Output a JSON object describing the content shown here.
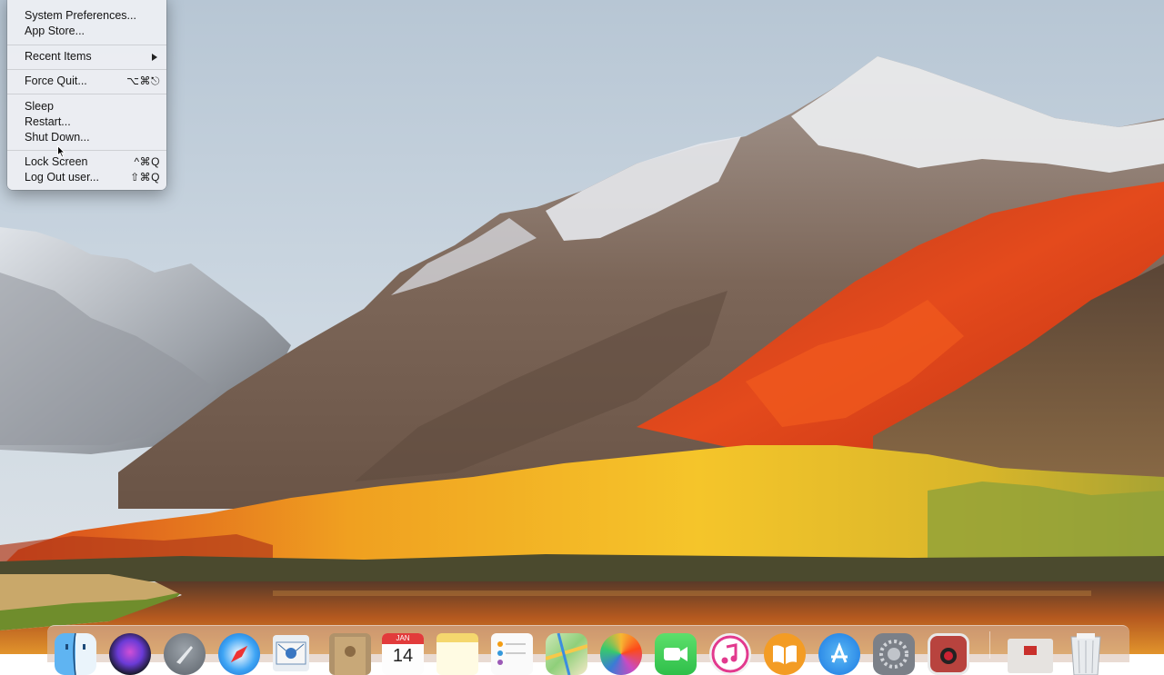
{
  "menu": {
    "items": [
      {
        "label": "System Preferences...",
        "shortcut": ""
      },
      {
        "label": "App Store...",
        "shortcut": ""
      },
      {
        "label": "Recent Items",
        "shortcut": ""
      },
      {
        "label": "Force Quit...",
        "shortcut": "⌥⌘⎋"
      },
      {
        "label": "Sleep",
        "shortcut": ""
      },
      {
        "label": "Restart...",
        "shortcut": ""
      },
      {
        "label": "Shut Down...",
        "shortcut": ""
      },
      {
        "label": "Lock Screen",
        "shortcut": "^⌘Q"
      },
      {
        "label": "Log Out user...",
        "shortcut": "⇧⌘Q"
      }
    ]
  },
  "dock": {
    "calendar_month": "JAN",
    "calendar_day": "14",
    "apps": [
      "finder-icon",
      "siri-icon",
      "launchpad-icon",
      "safari-icon",
      "mail-icon",
      "contacts-icon",
      "calendar-icon",
      "notes-icon",
      "reminders-icon",
      "maps-icon",
      "photos-icon",
      "facetime-icon",
      "itunes-icon",
      "ibooks-icon",
      "app-store-icon",
      "system-preferences-icon",
      "photo-booth-icon",
      "downloads-stack-icon",
      "trash-icon"
    ]
  },
  "colors": {
    "menu_bg": "#eceef2",
    "sky": "#c9d6e2",
    "autumn_red": "#d8361a",
    "autumn_yellow": "#e9b320"
  }
}
